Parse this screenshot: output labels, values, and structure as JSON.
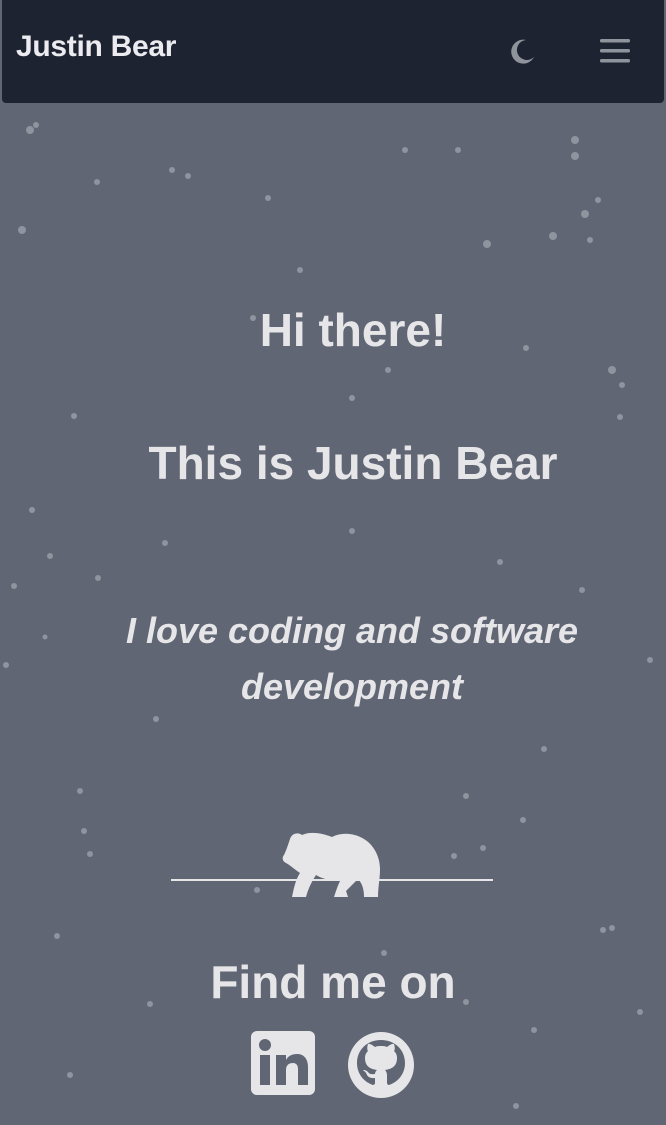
{
  "navbar": {
    "brand": "Justin Bear",
    "theme_icon": "moon-icon",
    "menu_icon": "hamburger-menu-icon"
  },
  "hero": {
    "greeting": "Hi there!",
    "intro": "This is Justin Bear",
    "tagline": "I love coding and software development",
    "bear_icon": "bear-icon"
  },
  "socials": {
    "heading": "Find me on",
    "links": [
      {
        "icon": "linkedin-icon"
      },
      {
        "icon": "github-icon"
      }
    ]
  },
  "colors": {
    "navbar_bg": "#1e2332",
    "page_bg": "#606674",
    "text": "#e6e6e9",
    "icon_muted": "#8f939c"
  }
}
